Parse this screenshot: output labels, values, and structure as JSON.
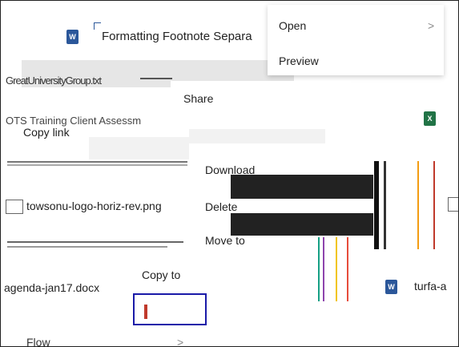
{
  "files": [
    {
      "name": "Formatting Footnote Separa",
      "icon": "word-icon"
    },
    {
      "name": "GreatUniversityGroup.txt",
      "icon": "text-file-icon"
    },
    {
      "name": "OTS Training Client Assessm",
      "icon": "word-icon"
    },
    {
      "name": "towsonu-logo-horiz-rev.png",
      "icon": "image-icon"
    },
    {
      "name": "agenda-jan17.docx",
      "icon": "word-icon"
    },
    {
      "name": "turfa-a",
      "icon": "word-icon"
    }
  ],
  "context_menu_top": {
    "open": "Open",
    "preview": "Preview"
  },
  "context_menu_mid": {
    "share": "Share",
    "copy_link": "Copy link"
  },
  "context_menu_low": {
    "download": "Download",
    "delete": "Delete",
    "move_to": "Move to",
    "copy_to": "Copy to",
    "flow": "Flow"
  },
  "chevron_glyph": ">",
  "colors": {
    "word": "#2b579a",
    "excel": "#217346",
    "selection": "#1a1aa8"
  }
}
